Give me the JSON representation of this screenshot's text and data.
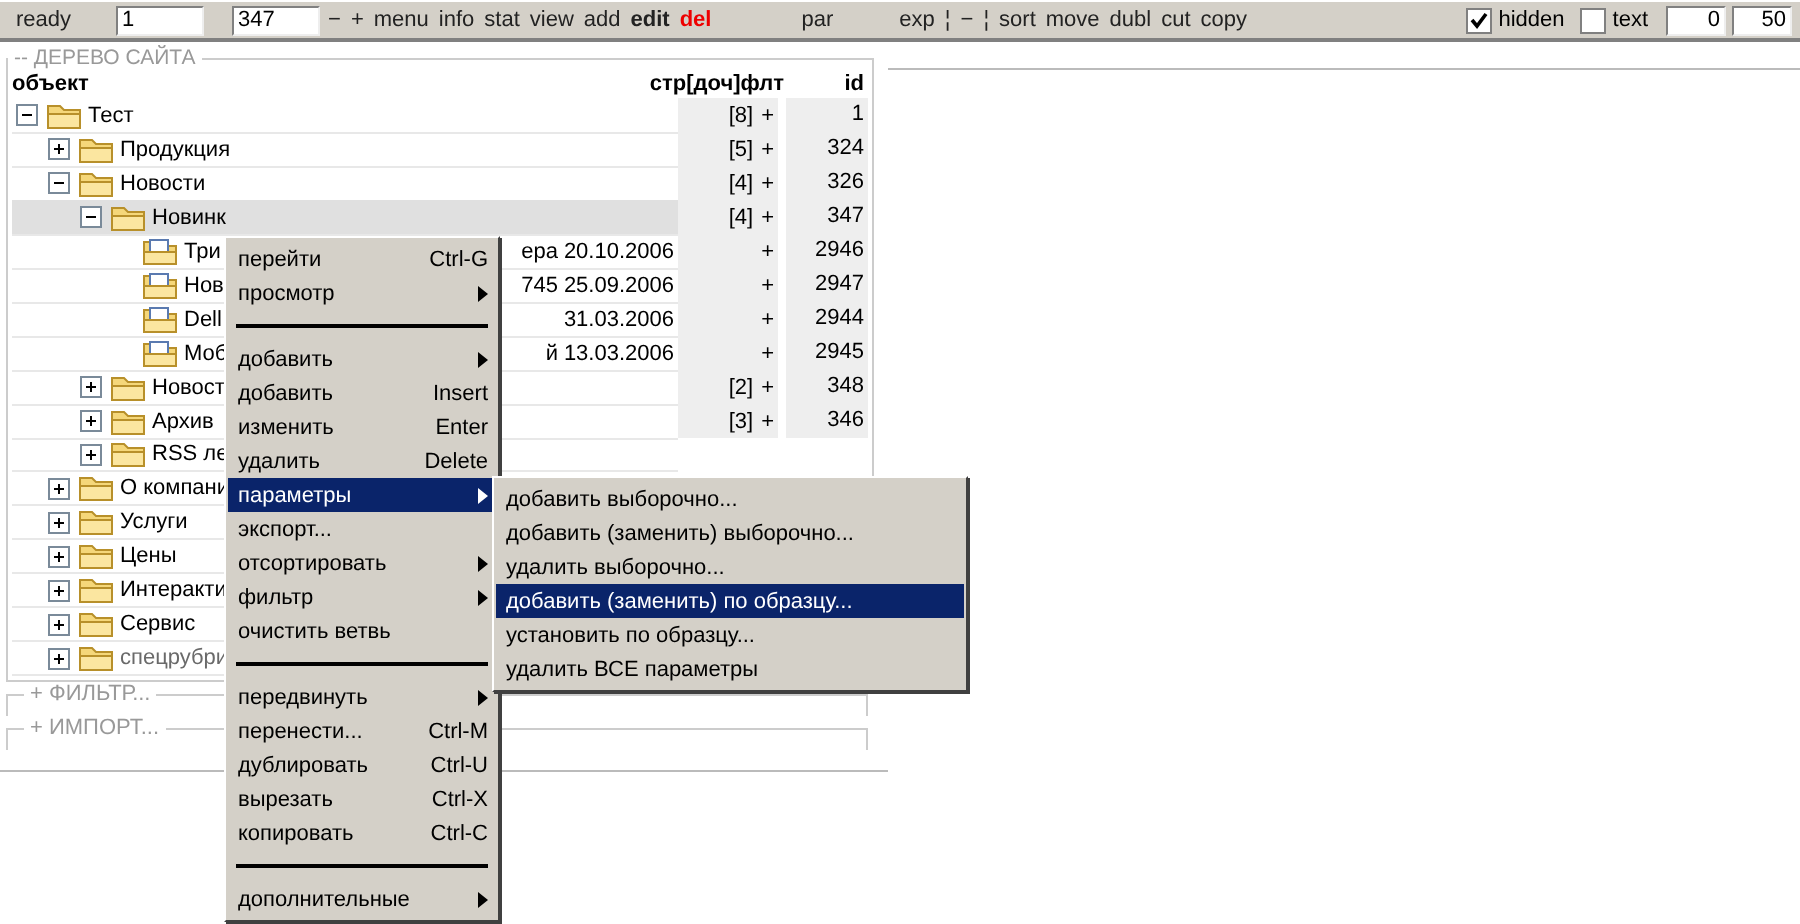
{
  "toolbar": {
    "status": "ready",
    "fields": [
      "1",
      "347"
    ],
    "links": [
      {
        "label": "−",
        "kind": "plain"
      },
      {
        "label": "+",
        "kind": "plain"
      },
      {
        "label": "menu",
        "kind": "plain"
      },
      {
        "label": "info",
        "kind": "plain"
      },
      {
        "label": "stat",
        "kind": "plain"
      },
      {
        "label": "view",
        "kind": "plain"
      },
      {
        "label": "add",
        "kind": "plain"
      },
      {
        "label": "edit",
        "kind": "bold"
      },
      {
        "label": "del",
        "kind": "danger"
      }
    ],
    "links2": [
      {
        "label": "par",
        "kind": "plain"
      }
    ],
    "links3": [
      {
        "label": "exp",
        "kind": "plain"
      },
      {
        "label": "¦",
        "kind": "plain"
      },
      {
        "label": "−",
        "kind": "plain"
      },
      {
        "label": "¦",
        "kind": "plain"
      },
      {
        "label": "sort",
        "kind": "plain"
      },
      {
        "label": "move",
        "kind": "plain"
      },
      {
        "label": "dubl",
        "kind": "plain"
      },
      {
        "label": "cut",
        "kind": "plain"
      },
      {
        "label": "copy",
        "kind": "plain"
      }
    ],
    "options": [
      {
        "label": "hidden",
        "checked": true
      },
      {
        "label": "text",
        "checked": false
      }
    ],
    "range": [
      "0",
      "50"
    ]
  },
  "tree_panel": {
    "legend": "-- ДЕРЕВО САЙТА",
    "columns": [
      "объект",
      "стр[доч]флт",
      "id"
    ],
    "rows": [
      {
        "name": "Тест",
        "kind": "folder",
        "expanded": true,
        "selected": false,
        "count": "[8]",
        "flag": "+",
        "id": "1",
        "children": [
          {
            "name": "Продукция",
            "kind": "folder",
            "expanded": false,
            "selected": false,
            "count": "[5]",
            "flag": "+",
            "id": "324"
          },
          {
            "name": "Новости",
            "kind": "folder",
            "expanded": true,
            "selected": false,
            "count": "[4]",
            "flag": "+",
            "id": "326",
            "children": [
              {
                "name": "Новинк",
                "kind": "folder",
                "expanded": true,
                "selected": true,
                "count": "[4]",
                "flag": "+",
                "id": "347",
                "children": [
                  {
                    "name": "Три",
                    "kind": "page",
                    "selected": false,
                    "tail": "ера",
                    "date": "20.10.2006",
                    "flag": "+",
                    "id": "2946"
                  },
                  {
                    "name": "Нов",
                    "kind": "page",
                    "selected": false,
                    "tail": "745",
                    "date": "25.09.2006",
                    "flag": "+",
                    "id": "2947"
                  },
                  {
                    "name": "Dell",
                    "kind": "page",
                    "selected": false,
                    "date": "31.03.2006",
                    "flag": "+",
                    "id": "2944"
                  },
                  {
                    "name": "Моб",
                    "kind": "page",
                    "selected": false,
                    "tail": "й",
                    "date": "13.03.2006",
                    "flag": "+",
                    "id": "2945"
                  }
                ]
              },
              {
                "name": "Новост",
                "kind": "folder",
                "expanded": false,
                "selected": false,
                "count": "[2]",
                "flag": "+",
                "id": "348"
              },
              {
                "name": "Архив",
                "kind": "folder",
                "expanded": false,
                "selected": false,
                "count": "[3]",
                "flag": "+",
                "id": "346"
              },
              {
                "name": "RSS ле",
                "kind": "folder",
                "expanded": false,
                "selected": false
              }
            ]
          },
          {
            "name": "О компани",
            "kind": "folder",
            "expanded": false,
            "selected": false
          },
          {
            "name": "Услуги",
            "kind": "folder",
            "expanded": false,
            "selected": false
          },
          {
            "name": "Цены",
            "kind": "folder",
            "expanded": false,
            "selected": false
          },
          {
            "name": "Интеракти",
            "kind": "folder",
            "expanded": false,
            "selected": false
          },
          {
            "name": "Сервис",
            "kind": "folder",
            "expanded": false,
            "selected": false
          },
          {
            "name": "спецрубри",
            "kind": "folder",
            "expanded": false,
            "selected": false,
            "disabled": true
          }
        ]
      }
    ]
  },
  "collapsed_panels": [
    "+ ФИЛЬТР...",
    "+ ИМПОРТ..."
  ],
  "context_menu": [
    {
      "kind": "item",
      "label": "перейти",
      "shortcut": "Ctrl-G",
      "submenu": false,
      "selected": false
    },
    {
      "kind": "item",
      "label": "просмотр",
      "submenu": true,
      "selected": false
    },
    {
      "kind": "separator"
    },
    {
      "kind": "item",
      "label": "добавить",
      "submenu": true,
      "selected": false
    },
    {
      "kind": "item",
      "label": "добавить",
      "shortcut": "Insert",
      "submenu": false,
      "selected": false
    },
    {
      "kind": "item",
      "label": "изменить",
      "shortcut": "Enter",
      "submenu": false,
      "selected": false
    },
    {
      "kind": "item",
      "label": "удалить",
      "shortcut": "Delete",
      "submenu": false,
      "selected": false
    },
    {
      "kind": "item",
      "label": "параметры",
      "submenu": true,
      "selected": true
    },
    {
      "kind": "item",
      "label": "экспорт...",
      "submenu": false,
      "selected": false
    },
    {
      "kind": "item",
      "label": "отсортировать",
      "submenu": true,
      "selected": false
    },
    {
      "kind": "item",
      "label": "фильтр",
      "submenu": true,
      "selected": false
    },
    {
      "kind": "item",
      "label": "очистить ветвь",
      "submenu": false,
      "selected": false
    },
    {
      "kind": "separator"
    },
    {
      "kind": "item",
      "label": "передвинуть",
      "submenu": true,
      "selected": false
    },
    {
      "kind": "item",
      "label": "перенести...",
      "shortcut": "Ctrl-M",
      "submenu": false,
      "selected": false
    },
    {
      "kind": "item",
      "label": "дублировать",
      "shortcut": "Ctrl-U",
      "submenu": false,
      "selected": false
    },
    {
      "kind": "item",
      "label": "вырезать",
      "shortcut": "Ctrl-X",
      "submenu": false,
      "selected": false
    },
    {
      "kind": "item",
      "label": "копировать",
      "shortcut": "Ctrl-C",
      "submenu": false,
      "selected": false
    },
    {
      "kind": "separator"
    },
    {
      "kind": "item",
      "label": "дополнительные",
      "submenu": true,
      "selected": false
    }
  ],
  "submenu": [
    {
      "label": "добавить выборочно...",
      "selected": false
    },
    {
      "label": "добавить (заменить) выборочно...",
      "selected": false
    },
    {
      "label": "удалить выборочно...",
      "selected": false
    },
    {
      "label": "добавить (заменить) по образцу...",
      "selected": true
    },
    {
      "label": "установить по образцу...",
      "selected": false
    },
    {
      "label": "удалить ВСЕ параметры",
      "selected": false
    }
  ]
}
